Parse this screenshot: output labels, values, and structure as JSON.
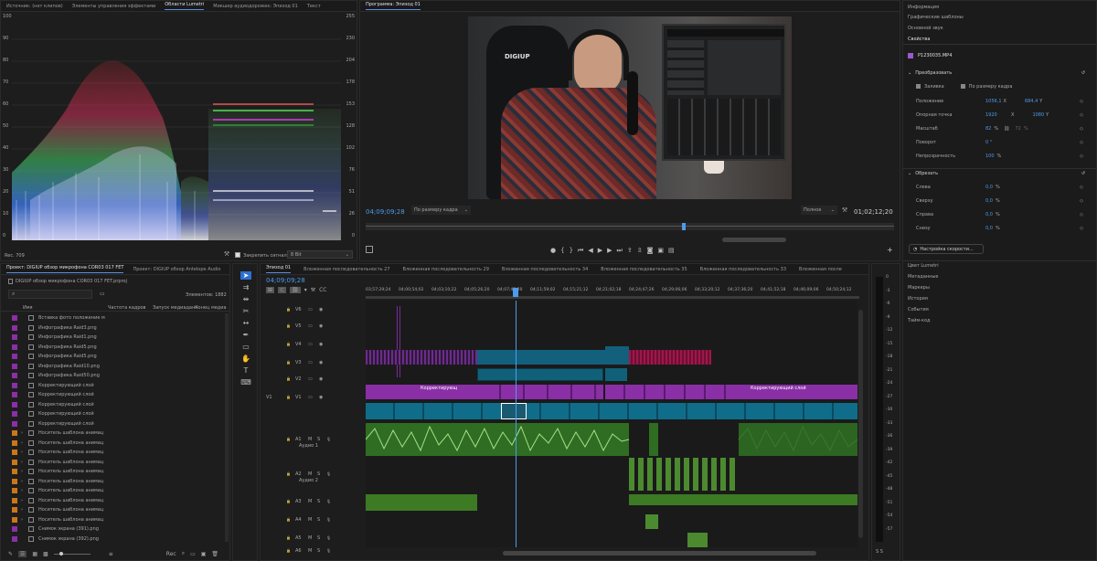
{
  "colors": {
    "accent": "#4d9bea",
    "purple": "#8a2fa6",
    "teal": "#0f6d8a",
    "green": "#3d7a24",
    "audio_green": "#2f6d22",
    "magenta": "#a0174b",
    "folder_orange": "#c9771a"
  },
  "source_panel": {
    "tabs": [
      "Источник: (нет клипов)",
      "Элементы управления эффектами",
      "Области Lumetri",
      "Микшер аудиодорожек: Эпизод 01",
      "Текст"
    ],
    "active_tab": "Области Lumetri",
    "scale_left": [
      "100",
      "90",
      "80",
      "70",
      "60",
      "50",
      "40",
      "30",
      "20",
      "10",
      "0"
    ],
    "scale_right": [
      "255",
      "230",
      "204",
      "178",
      "153",
      "128",
      "102",
      "76",
      "51",
      "26",
      "0"
    ],
    "bottom_left": "Rec. 709",
    "clamp_label": "Закрепить сигнал",
    "clamp_value": "8 Bit"
  },
  "program": {
    "title": "Программа: Эпизод 01",
    "timecode": "04;09;09;28",
    "fit": "По размеру кадра",
    "quality": "Полное",
    "duration": "01;02;12;20",
    "watermark": "DIGIUP"
  },
  "essential": {
    "tabs": [
      "Информация",
      "Графические шаблоны",
      "Основной звук",
      "Свойства"
    ],
    "file_name": "P1230035.MP4",
    "transform_title": "Преобразовать",
    "fill_label": "Заливка",
    "fit_frame_label": "По размеру кадра",
    "position_label": "Положение",
    "position_x": "1056,1",
    "position_y": "684,4",
    "anchor_label": "Опорная точка",
    "anchor_x": "1920",
    "anchor_y": "1080",
    "scale_label": "Масштаб",
    "scale_value": "82",
    "scale_value2": "72",
    "rotation_label": "Поворот",
    "rotation_value": "0 °",
    "opacity_label": "Непрозрачность",
    "opacity_value": "100",
    "crop_title": "Обрезать",
    "crop_left_label": "Слева",
    "crop_top_label": "Сверху",
    "crop_right_label": "Справа",
    "crop_bottom_label": "Снизу",
    "crop_value": "0,0",
    "unit_x": "X",
    "unit_y": "Y",
    "unit_pct": "%",
    "speed_btn": "Настройка скорости...",
    "more_tabs": [
      "Цвет Lumetri",
      "Метаданные",
      "Маркеры",
      "История",
      "События",
      "Тайм-код"
    ]
  },
  "project": {
    "tabs": [
      "Проект: DIGIUP обзор микрофона COR03 017 FET",
      "Проект: DIGIUP обзор Antelope Audio"
    ],
    "file": "DIGIUP обзор микрофона COR03 017 FET.prproj",
    "count": "Элементов: 1882",
    "columns": [
      "Имя",
      "Частота кадров",
      "Запуск медиаданн",
      "Конец медиа"
    ],
    "items": [
      {
        "name": "Вставка фото положение м",
        "type": "purple",
        "folder": false
      },
      {
        "name": "Инфографика Raid3.png",
        "type": "purple",
        "folder": false
      },
      {
        "name": "Инфографика Raid1.png",
        "type": "purple",
        "folder": false
      },
      {
        "name": "Инфографика Raid5.png",
        "type": "purple",
        "folder": false
      },
      {
        "name": "Инфографика Raid5.png",
        "type": "purple",
        "folder": false
      },
      {
        "name": "Инфографика Raid10.png",
        "type": "purple",
        "folder": false
      },
      {
        "name": "Инфографика Raid50.png",
        "type": "purple",
        "folder": false
      },
      {
        "name": "Корректирующий слой",
        "type": "purple",
        "folder": false
      },
      {
        "name": "Корректирующий слой",
        "type": "purple",
        "folder": false
      },
      {
        "name": "Корректирующий слой",
        "type": "purple",
        "folder": false
      },
      {
        "name": "Корректирующий слой",
        "type": "purple",
        "folder": false
      },
      {
        "name": "Корректирующий слой",
        "type": "purple",
        "folder": false
      },
      {
        "name": "Носитель шаблона анимац",
        "type": "orange",
        "folder": true
      },
      {
        "name": "Носитель шаблона анимац",
        "type": "orange",
        "folder": true
      },
      {
        "name": "Носитель шаблона анимац",
        "type": "orange",
        "folder": true
      },
      {
        "name": "Носитель шаблона анимац",
        "type": "orange",
        "folder": true
      },
      {
        "name": "Носитель шаблона анимац",
        "type": "orange",
        "folder": true
      },
      {
        "name": "Носитель шаблона анимац",
        "type": "orange",
        "folder": true
      },
      {
        "name": "Носитель шаблона анимац",
        "type": "orange",
        "folder": true
      },
      {
        "name": "Носитель шаблона анимац",
        "type": "orange",
        "folder": true
      },
      {
        "name": "Носитель шаблона анимац",
        "type": "orange",
        "folder": true
      },
      {
        "name": "Носитель шаблона анимац",
        "type": "orange",
        "folder": true
      },
      {
        "name": "Снимок экрана (391).png",
        "type": "purple",
        "folder": false
      },
      {
        "name": "Снимок экрана (392).png",
        "type": "purple",
        "folder": false
      }
    ],
    "bottom_label": "Rec"
  },
  "timeline": {
    "tabs": [
      "Эпизод 01",
      "Вложенная последовательность 27",
      "Вложенная последовательность 29",
      "Вложенная последовательность 34",
      "Вложенная последовательность 35",
      "Вложенная последовательность 33",
      "Вложенная после"
    ],
    "timecode": "04;09;09;28",
    "ruler": [
      "03;57;29;24",
      "04;00;54;02",
      "04;03;10;22",
      "04;05;26;20",
      "04;07;42;20",
      "04;11;59;02",
      "04;15;21;12",
      "04;21;02;18",
      "04;24;47;26",
      "04;29;06;06",
      "04;33;20;12",
      "04;37;36;20",
      "04;41;52;18",
      "04;46;09;06",
      "04;50;24;12"
    ],
    "video_tracks": [
      "V6",
      "V5",
      "V4",
      "V3",
      "V2",
      "V1"
    ],
    "source_v": "V1",
    "audio_tracks": [
      "A1",
      "A2",
      "A3",
      "A4",
      "A5",
      "A6"
    ],
    "audio_names": [
      "Аудио 1",
      "Аудио 2"
    ],
    "adj_label": "Корректирующий слой",
    "adj_label_short": "Корректирующ",
    "meter_scale": [
      "0",
      "-3",
      "-6",
      "-9",
      "-12",
      "-15",
      "-18",
      "-21",
      "-24",
      "-27",
      "-30",
      "-33",
      "-36",
      "-39",
      "-42",
      "-45",
      "-48",
      "-51",
      "-54",
      "-57"
    ],
    "meter_footer": "S S"
  }
}
